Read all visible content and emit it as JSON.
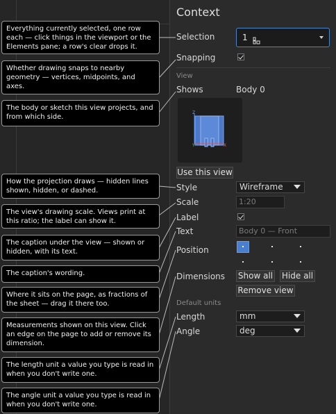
{
  "panel": {
    "title": "Context",
    "selection": {
      "label": "Selection",
      "value": "1"
    },
    "snapping": {
      "label": "Snapping",
      "checked": true
    },
    "view_section": "View",
    "shows": {
      "label": "Shows",
      "value": "Body 0"
    },
    "use_this_view": "Use this view",
    "style": {
      "label": "Style",
      "value": "Wireframe"
    },
    "scale": {
      "label": "Scale",
      "placeholder": "1:20"
    },
    "label_row": {
      "label": "Label",
      "checked": true
    },
    "text": {
      "label": "Text",
      "placeholder": "Body 0 — Front"
    },
    "position": {
      "label": "Position",
      "selected_index": 0
    },
    "dimensions": {
      "label": "Dimensions",
      "show_all": "Show all",
      "hide_all": "Hide all",
      "remove_view": "Remove view"
    },
    "default_units": "Default units",
    "length": {
      "label": "Length",
      "value": "mm"
    },
    "angle": {
      "label": "Angle",
      "value": "deg"
    },
    "accent": "#4a86c8",
    "preview_axes": {
      "z": "Z",
      "x": "X",
      "y": "Y"
    }
  },
  "tooltips": [
    "Everything currently selected, one row each — click things in the viewport or the Elements pane; a row's clear drops it.",
    "Whether drawing snaps to nearby geometry — vertices, midpoints, and axes.",
    "The body or sketch this view projects, and from which side.",
    "How the projection draws — hidden lines shown, hidden, or dashed.",
    "The view's drawing scale. Views print at this ratio; the label can show it.",
    "The caption under the view — shown or hidden, with its text.",
    "The caption's wording.",
    "Where it sits on the page, as fractions of the sheet — drag it there too.",
    "Measurements shown on this view. Click an edge on the page to add or remove its dimension.",
    "The length unit a value you type is read in when you don't write one.",
    "The angle unit a value you type is read in when you don't write one."
  ]
}
